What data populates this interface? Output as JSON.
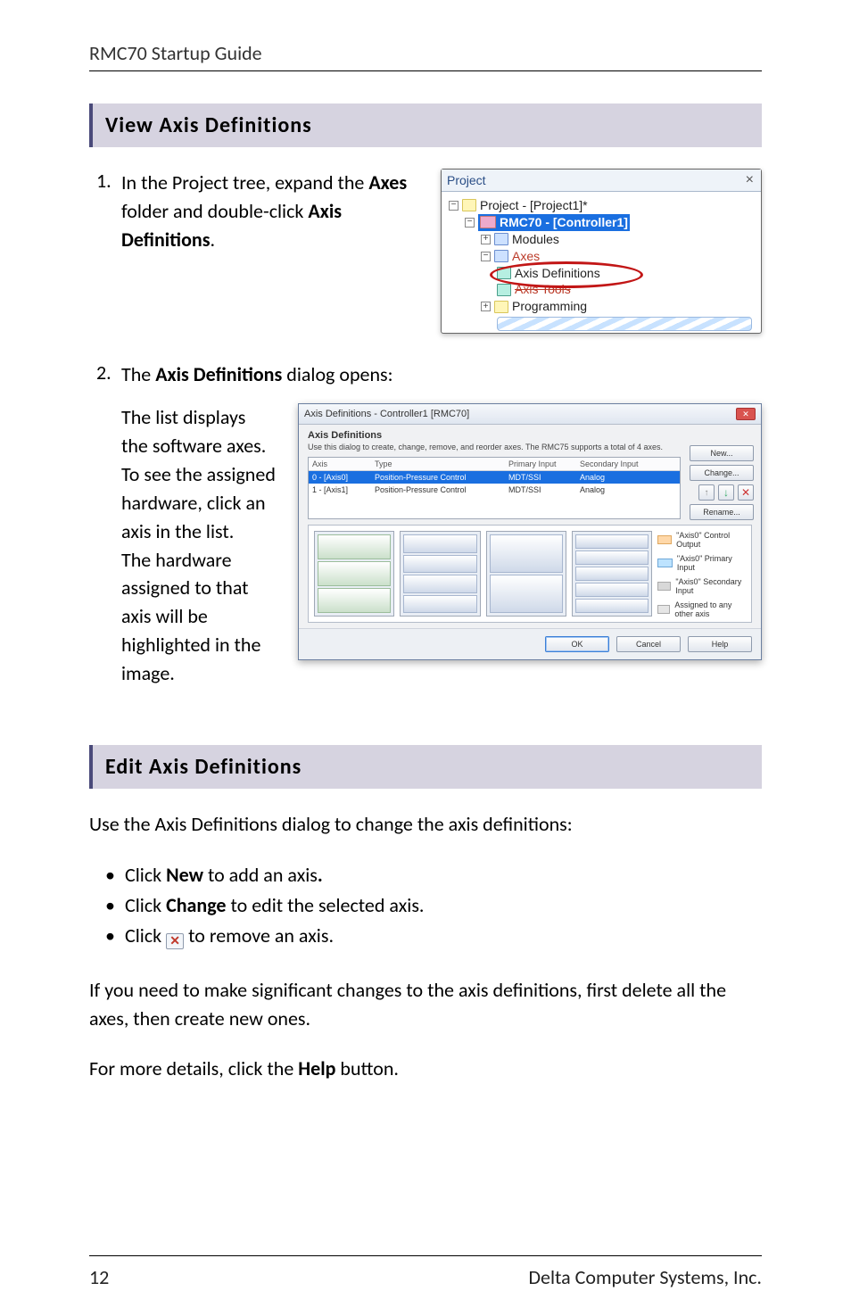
{
  "header": {
    "running": "RMC70 Startup Guide"
  },
  "footer": {
    "page": "12",
    "company": "Delta Computer Systems, Inc."
  },
  "sections": {
    "view": {
      "title": "View Axis Definitions",
      "step1_num": "1.",
      "step1_a": "In the Project tree, expand the ",
      "step1_b": "Axes",
      "step1_c": " folder and double-click ",
      "step1_d": "Axis Definitions",
      "step1_e": ".",
      "step2_num": "2.",
      "step2_a": "The ",
      "step2_b": "Axis Definitions",
      "step2_c": " dialog opens:",
      "explain": "The list displays the software axes. To see the assigned hardware, click an axis in the list.",
      "explain2": "The hardware assigned to that axis will be highlighted in the image."
    },
    "edit": {
      "title": "Edit Axis Definitions",
      "intro": "Use the Axis Definitions dialog to change the axis definitions:",
      "bul1_a": "Click ",
      "bul1_b": "New",
      "bul1_c": " to add an axis",
      "bul2_a": "Click ",
      "bul2_b": "Change",
      "bul2_c": " to edit the selected axis.",
      "bul3_a": "Click ",
      "bul3_b": " to remove an axis.",
      "p3": "If you need to make significant changes to the axis definitions, first delete all the axes, then create new ones.",
      "p4_a": "For more details, click the ",
      "p4_b": "Help",
      "p4_c": " button."
    }
  },
  "tree": {
    "hdr": "Project",
    "close": "×",
    "root": "Project - [Project1]*",
    "ctrl": "RMC70 - [Controller1]",
    "modules": "Modules",
    "axes": "Axes",
    "axisdef": "Axis Definitions",
    "axistools": "Axis Tools",
    "prog": "Programming"
  },
  "dialog": {
    "title": "Axis Definitions - Controller1 [RMC70]",
    "hdr": "Axis Definitions",
    "hint": "Use this dialog to create, change, remove, and reorder axes. The RMC75 supports a total of 4 axes.",
    "cols": {
      "c1": "Axis",
      "c2": "Type",
      "c3": "Primary Input",
      "c4": "Secondary Input"
    },
    "rows": [
      {
        "a": "0 - [Axis0]",
        "t": "Position-Pressure Control",
        "p": "MDT/SSI",
        "s": "Analog"
      },
      {
        "a": "1 - [Axis1]",
        "t": "Position-Pressure Control",
        "p": "MDT/SSI",
        "s": "Analog"
      }
    ],
    "btns": {
      "new": "New...",
      "change": "Change...",
      "rename": "Rename..."
    },
    "legend": {
      "l1": "\"Axis0\" Control Output",
      "l2": "\"Axis0\" Primary Input",
      "l3": "\"Axis0\" Secondary Input",
      "l4": "Assigned to any other axis"
    },
    "bottom": {
      "ok": "OK",
      "cancel": "Cancel",
      "help": "Help"
    }
  }
}
